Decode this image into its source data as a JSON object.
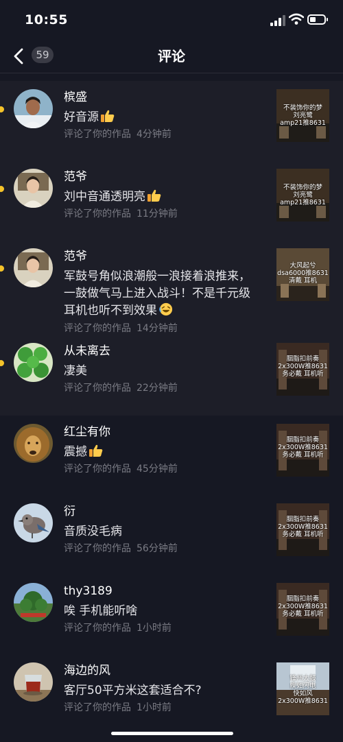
{
  "status_bar": {
    "time": "10:55"
  },
  "header": {
    "title": "评论",
    "count": "59"
  },
  "comments": [
    {
      "name": "槟盛",
      "text": "好音源",
      "emoji": true,
      "action": "评论了你的作品",
      "time": "4分钟前",
      "thumb_text": [
        "不装饰你的梦",
        "刘亮鹭",
        "amp21推8631"
      ]
    },
    {
      "name": "范爷",
      "text": "刘中音通透明亮",
      "emoji": true,
      "action": "评论了你的作品",
      "time": "11分钟前",
      "thumb_text": [
        "不装饰你的梦",
        "刘亮鹭",
        "amp21推8631"
      ]
    },
    {
      "name": "范爷",
      "text_lines": [
        "军鼓号角似浪潮般一浪接着浪推来，",
        "一鼓做气马上进入战斗！不是千元级",
        "耳机也听不到效果"
      ],
      "emoji": "laugh",
      "action": "评论了你的作品",
      "time": "14分钟前",
      "thumb_text": [
        "大风起兮",
        "dsa6000推8631",
        "清戴  耳机"
      ]
    },
    {
      "name": "从未离去",
      "text": "凄美",
      "emoji": false,
      "action": "评论了你的作品",
      "time": "22分钟前",
      "thumb_text": [
        "胭脂扣前奏",
        "2x300W推8631",
        "务必戴  耳机听"
      ]
    },
    {
      "name": "红尘有你",
      "text": "震撼",
      "emoji": true,
      "action": "评论了你的作品",
      "time": "45分钟前",
      "thumb_text": [
        "胭脂扣前奏",
        "2x300W推8631",
        "务必戴  耳机听"
      ]
    },
    {
      "name": "衍",
      "text": "音质没毛病",
      "emoji": false,
      "action": "评论了你的作品",
      "time": "56分钟前",
      "thumb_text": [
        "胭脂扣前奏",
        "2x300W推8631",
        "务必戴  耳机听"
      ]
    },
    {
      "name": "thy3189",
      "text": "唉 手机能听啥",
      "emoji": false,
      "action": "评论了你的作品",
      "time": "1小时前",
      "thumb_text": [
        "胭脂扣前奏",
        "2x300W推8631",
        "务必戴  耳机听"
      ]
    },
    {
      "name": "海边的风",
      "text": "客厅50平方米这套适合不?",
      "emoji": false,
      "action": "评论了你的作品",
      "time": "1小时前",
      "thumb_text": [
        "锋州大鼓",
        "疾如闪电",
        "快如风",
        "2x300W推8631"
      ]
    }
  ],
  "colors": {
    "background": "#161823",
    "unread_background": "#1d1e28",
    "unread_dot": "#f5c32a",
    "meta_text": "#7b7c85"
  }
}
